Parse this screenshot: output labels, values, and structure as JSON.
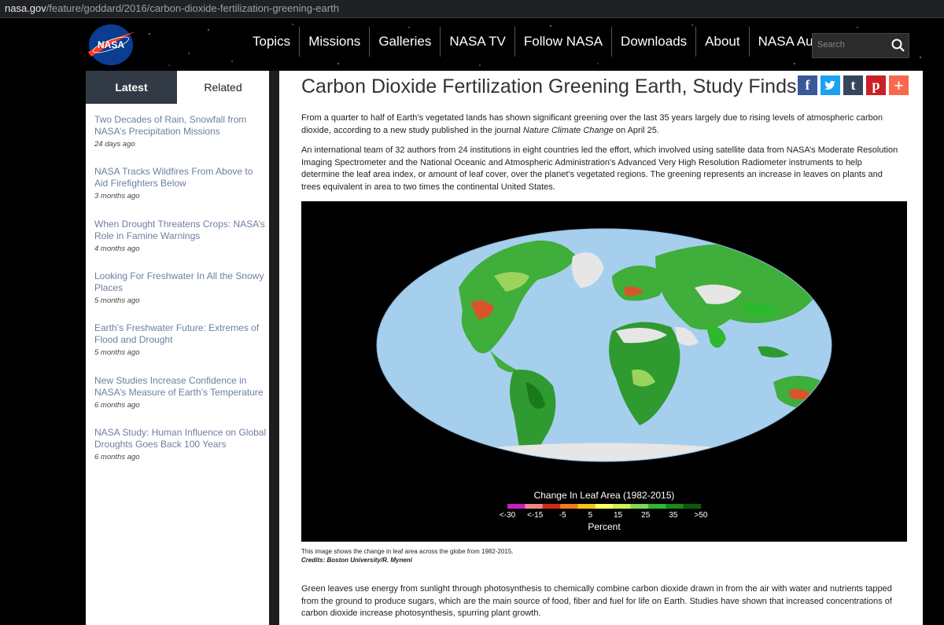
{
  "browser": {
    "url_host": "nasa.gov",
    "url_path": "/feature/goddard/2016/carbon-dioxide-fertilization-greening-earth"
  },
  "header": {
    "logo_text": "NASA",
    "nav": [
      "Topics",
      "Missions",
      "Galleries",
      "NASA TV",
      "Follow NASA",
      "Downloads",
      "About",
      "NASA Audiences"
    ],
    "search_placeholder": "Search"
  },
  "sidebar": {
    "tabs": [
      "Latest",
      "Related"
    ],
    "items": [
      {
        "title": "Two Decades of Rain, Snowfall from NASA’s Precipitation Missions",
        "date": "24 days ago"
      },
      {
        "title": "NASA Tracks Wildfires From Above to Aid Firefighters Below",
        "date": "3 months ago"
      },
      {
        "title": "When Drought Threatens Crops: NASA’s Role in Famine Warnings",
        "date": "4 months ago"
      },
      {
        "title": "Looking For Freshwater In All the Snowy Places",
        "date": "5 months ago"
      },
      {
        "title": "Earth’s Freshwater Future: Extremes of Flood and Drought",
        "date": "5 months ago"
      },
      {
        "title": "New Studies Increase Confidence in NASA’s Measure of Earth’s Temperature",
        "date": "6 months ago"
      },
      {
        "title": "NASA Study: Human Influence on Global Droughts Goes Back 100 Years",
        "date": "6 months ago"
      }
    ]
  },
  "article": {
    "title": "Carbon Dioxide Fertilization Greening Earth, Study Finds",
    "share": [
      "f",
      "t",
      "t",
      "p",
      "+"
    ],
    "p1_a": "From a quarter to half of Earth’s vegetated lands has shown significant greening over the last 35 years largely due to rising levels of atmospheric carbon dioxide, according to a new study published in the journal ",
    "p1_journal": "Nature Climate Change",
    "p1_b": " on April 25.",
    "p2": "An international team of 32 authors from 24 institutions in eight countries led the effort, which involved using satellite data from NASA’s Moderate Resolution Imaging Spectrometer and the National Oceanic and Atmospheric Administration’s Advanced Very High Resolution Radiometer instruments to help determine the leaf area index, or amount of leaf cover, over the planet’s vegetated regions. The greening represents an increase in leaves on plants and trees equivalent in area to two times the continental United States.",
    "figure": {
      "legend_title": "Change In Leaf Area (1982-2015)",
      "legend_ticks": [
        "<-30",
        "<-15",
        "-5",
        "5",
        "15",
        "25",
        "35",
        ">50"
      ],
      "legend_unit": "Percent",
      "legend_colors": [
        "#c21fc4",
        "#e88a8a",
        "#d42a1a",
        "#f07a20",
        "#f5c518",
        "#ffff66",
        "#cfee5a",
        "#7ed957",
        "#2eb82e",
        "#1a8a1a",
        "#0a5a0a"
      ]
    },
    "caption": "This image shows the change in leaf area across the globe from 1982-2015.",
    "credit": "Credits: Boston University/R. Myneni",
    "p3": "Green leaves use energy from sunlight through photosynthesis to chemically combine carbon dioxide drawn in from the air with water and nutrients tapped from the ground to produce sugars, which are the main source of food, fiber and fuel for life on Earth. Studies have shown that increased concentrations of carbon dioxide increase photosynthesis, spurring plant growth."
  },
  "colors": {
    "nasa_blue": "#0b3d91",
    "nasa_red": "#fc3d21",
    "tab_active": "#323a45",
    "link": "#6e7fa1",
    "facebook": "#3b5998",
    "twitter": "#1da1f2",
    "tumblr": "#35465c",
    "pinterest": "#cb2027",
    "addthis": "#f8694d",
    "ocean": "#a6cfee"
  }
}
